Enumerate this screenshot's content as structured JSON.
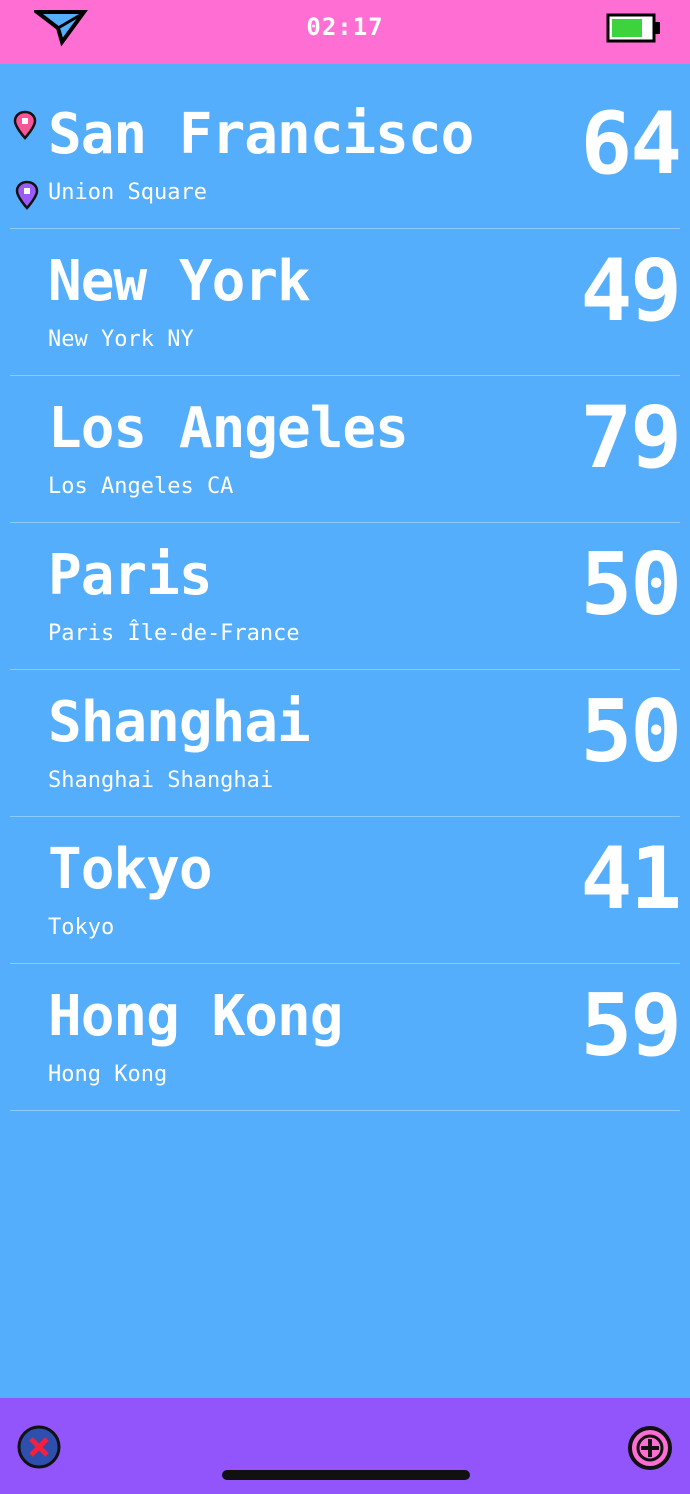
{
  "status_bar": {
    "time": "02:17",
    "location_icon": "location-arrow-icon",
    "battery_icon": "battery-icon"
  },
  "colors": {
    "status_bar": "#FF6FD3",
    "background": "#55AEFB",
    "bottom_bar": "#9155FB",
    "pin_pink": "#F75597",
    "pin_purple": "#9A5CF5",
    "text": "#FFFFFF",
    "battery_fill": "#3DD33D"
  },
  "rows": [
    {
      "city": "San Francisco",
      "sub": "Union Square",
      "temp": "64",
      "current_location": true
    },
    {
      "city": "New York",
      "sub": "New York NY",
      "temp": "49"
    },
    {
      "city": "Los Angeles",
      "sub": "Los Angeles CA",
      "temp": "79"
    },
    {
      "city": "Paris",
      "sub": "Paris Île-de-France",
      "temp": "50"
    },
    {
      "city": "Shanghai",
      "sub": "Shanghai Shanghai",
      "temp": "50"
    },
    {
      "city": "Tokyo",
      "sub": "Tokyo",
      "temp": "41"
    },
    {
      "city": "Hong Kong",
      "sub": "Hong Kong",
      "temp": "59"
    }
  ],
  "bottom_bar": {
    "remove_icon": "remove-x-icon",
    "add_icon": "add-plus-icon"
  }
}
